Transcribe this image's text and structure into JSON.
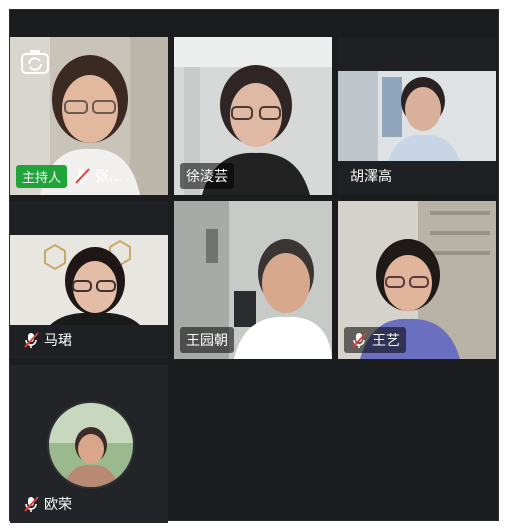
{
  "meeting": {
    "participants": [
      {
        "name": "张...",
        "host_label": "主持人",
        "muted": true
      },
      {
        "name": "徐淩芸",
        "muted": false
      },
      {
        "name": "胡澤高",
        "muted": false
      },
      {
        "name": "马珺",
        "muted": true
      },
      {
        "name": "王园朝",
        "muted": false,
        "active_speaker": true
      },
      {
        "name": "王艺",
        "muted": true
      },
      {
        "name": "欧荣",
        "muted": true
      }
    ]
  },
  "colors": {
    "accent": "#20a43a",
    "background": "#1b1c1e",
    "tile": "#232427"
  },
  "icons": {
    "camera_switch": "camera-switch-icon",
    "muted": "mic-muted-icon"
  }
}
